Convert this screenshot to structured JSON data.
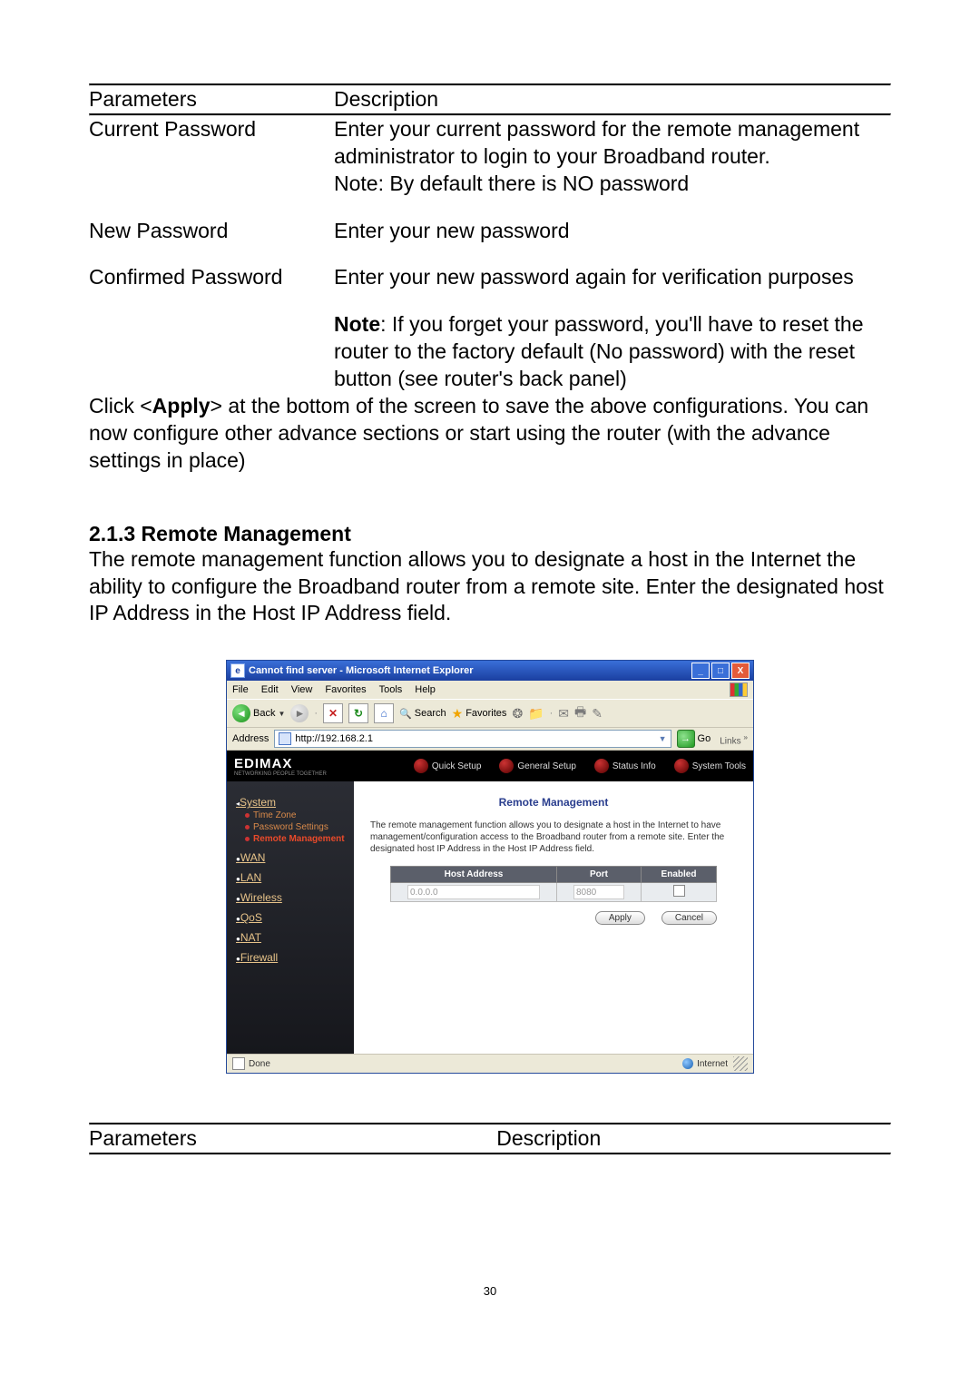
{
  "table1": {
    "headers": {
      "param": "Parameters",
      "desc": "Description"
    },
    "rows": [
      {
        "param": "Current Password",
        "desc": "Enter your current password for the remote management administrator to login to your Broadband router.\nNote: By default there is NO password"
      },
      {
        "param": "New Password",
        "desc": "Enter your new password"
      },
      {
        "param": "Confirmed Password",
        "desc": "Enter your new password again for verification purposes"
      }
    ],
    "note_label": "Note",
    "note_text": ": If you forget your password, you'll have to reset the router to the factory default (No password) with the reset button (see router's back panel)"
  },
  "apply_para_pre": "Click <",
  "apply_bold": "Apply",
  "apply_para_post": "> at the bottom of the screen to save the above configurations. You can now configure other advance sections or start using the router (with the advance settings in place)",
  "section": {
    "num": "2.1.3",
    "title": "Remote Management"
  },
  "section_body": "The remote management function allows you to designate a host in the Internet the ability to configure the Broadband router from a remote site. Enter the designated host IP Address in the Host IP Address field.",
  "ie": {
    "title": "Cannot find server - Microsoft Internet Explorer",
    "menus": [
      "File",
      "Edit",
      "View",
      "Favorites",
      "Tools",
      "Help"
    ],
    "back": "Back",
    "search": "Search",
    "favorites": "Favorites",
    "address_label": "Address",
    "address_value": "http://192.168.2.1",
    "go": "Go",
    "links": "Links"
  },
  "router": {
    "brand": "EDIMAX",
    "brand_sub": "NETWORKING PEOPLE TOGETHER",
    "tabs": [
      "Quick Setup",
      "General Setup",
      "Status Info",
      "System Tools"
    ],
    "sidebar": {
      "system": "System",
      "system_items": [
        "Time Zone",
        "Password Settings",
        "Remote Management"
      ],
      "others": [
        "WAN",
        "LAN",
        "Wireless",
        "QoS",
        "NAT",
        "Firewall"
      ]
    },
    "content": {
      "title": "Remote Management",
      "desc": "The remote management function allows you to designate a host in the Internet to have management/configuration access to the Broadband router from a remote site. Enter the designated host IP Address in the Host IP Address field.",
      "th_host": "Host Address",
      "th_port": "Port",
      "th_enabled": "Enabled",
      "host_value": "0.0.0.0",
      "port_value": "8080",
      "apply": "Apply",
      "cancel": "Cancel"
    }
  },
  "statusbar": {
    "done": "Done",
    "internet": "Internet"
  },
  "table2": {
    "param": "Parameters",
    "desc": "Description"
  },
  "page_number": "30"
}
